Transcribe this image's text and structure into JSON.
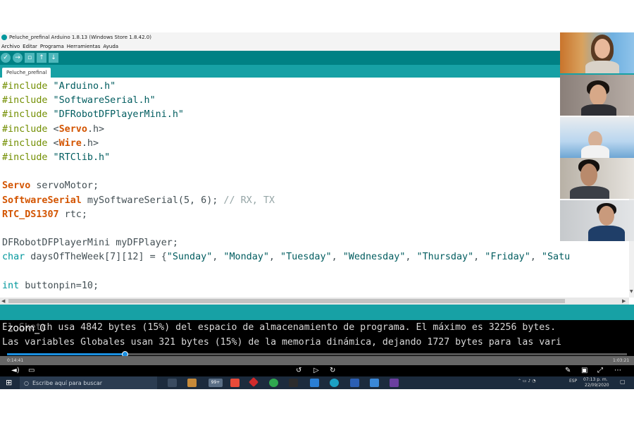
{
  "window": {
    "title": "Peluche_prefinal Arduino 1.8.13 (Windows Store 1.8.42.0)",
    "menu": [
      "Archivo",
      "Editar",
      "Programa",
      "Herramientas",
      "Ayuda"
    ]
  },
  "toolbar": {
    "verify_icon": "checkmark-icon",
    "upload_icon": "right-arrow-icon",
    "new_icon": "new-file-icon",
    "open_icon": "up-arrow-icon",
    "save_icon": "down-arrow-icon"
  },
  "editor": {
    "tab_label": "Peluche_prefinal",
    "lines": [
      [
        {
          "t": "#include",
          "c": "kw"
        },
        {
          "t": " \"Arduino.h\"",
          "c": "str"
        }
      ],
      [
        {
          "t": "#include",
          "c": "kw"
        },
        {
          "t": " \"SoftwareSerial.h\"",
          "c": "str"
        }
      ],
      [
        {
          "t": "#include",
          "c": "kw"
        },
        {
          "t": " \"DFRobotDFPlayerMini.h\"",
          "c": "str"
        }
      ],
      [
        {
          "t": "#include",
          "c": "kw"
        },
        {
          "t": " <",
          "c": ""
        },
        {
          "t": "Servo",
          "c": "cls"
        },
        {
          "t": ".h>",
          "c": ""
        }
      ],
      [
        {
          "t": "#include",
          "c": "kw"
        },
        {
          "t": " <",
          "c": ""
        },
        {
          "t": "Wire",
          "c": "cls"
        },
        {
          "t": ".h>",
          "c": ""
        }
      ],
      [
        {
          "t": "#include",
          "c": "kw"
        },
        {
          "t": " \"RTClib.h\"",
          "c": "str"
        }
      ],
      [],
      [
        {
          "t": "Servo",
          "c": "cls"
        },
        {
          "t": " servoMotor;",
          "c": ""
        }
      ],
      [
        {
          "t": "SoftwareSerial",
          "c": "cls"
        },
        {
          "t": " mySoftwareSerial(5, 6); ",
          "c": ""
        },
        {
          "t": "// RX, TX",
          "c": "cmt"
        }
      ],
      [
        {
          "t": "RTC_DS1307",
          "c": "cls"
        },
        {
          "t": " rtc;",
          "c": ""
        }
      ],
      [],
      [
        {
          "t": "DFRobotDFPlayerMini myDFPlayer;",
          "c": ""
        }
      ],
      [
        {
          "t": "char",
          "c": "type"
        },
        {
          "t": " daysOfTheWeek[7][12] = {",
          "c": ""
        },
        {
          "t": "\"Sunday\"",
          "c": "str"
        },
        {
          "t": ", ",
          "c": ""
        },
        {
          "t": "\"Monday\"",
          "c": "str"
        },
        {
          "t": ", ",
          "c": ""
        },
        {
          "t": "\"Tuesday\"",
          "c": "str"
        },
        {
          "t": ", ",
          "c": ""
        },
        {
          "t": "\"Wednesday\"",
          "c": "str"
        },
        {
          "t": ", ",
          "c": ""
        },
        {
          "t": "\"Thursday\"",
          "c": "str"
        },
        {
          "t": ", ",
          "c": ""
        },
        {
          "t": "\"Friday\"",
          "c": "str"
        },
        {
          "t": ", ",
          "c": ""
        },
        {
          "t": "\"Satu",
          "c": "str"
        }
      ],
      [],
      [
        {
          "t": "int",
          "c": "type"
        },
        {
          "t": " buttonpin=10;",
          "c": ""
        }
      ]
    ]
  },
  "console": {
    "line1": "El Sketch usa 4842 bytes (15%) del espacio de almacenamiento de programa. El máximo es 32256 bytes.",
    "line2": "Las variables Globales usan 321 bytes (15%) de la memoria dinámica, dejando 1727 bytes para las vari"
  },
  "video": {
    "overlay_label": "zoom_0",
    "elapsed": "0:14:41",
    "duration": "1:03:21",
    "progress": 0.19
  },
  "taskbar": {
    "search_placeholder": "Escribe aquí para buscar",
    "badge": "99+",
    "language": "ESP",
    "time": "07:13 p. m.",
    "date": "22/09/2020"
  },
  "colors": {
    "arduino_teal": "#00979c",
    "toolbar": "#008184",
    "keyword_orange": "#d35400",
    "include_green": "#728e00",
    "seek_blue": "#1a8fe0"
  }
}
